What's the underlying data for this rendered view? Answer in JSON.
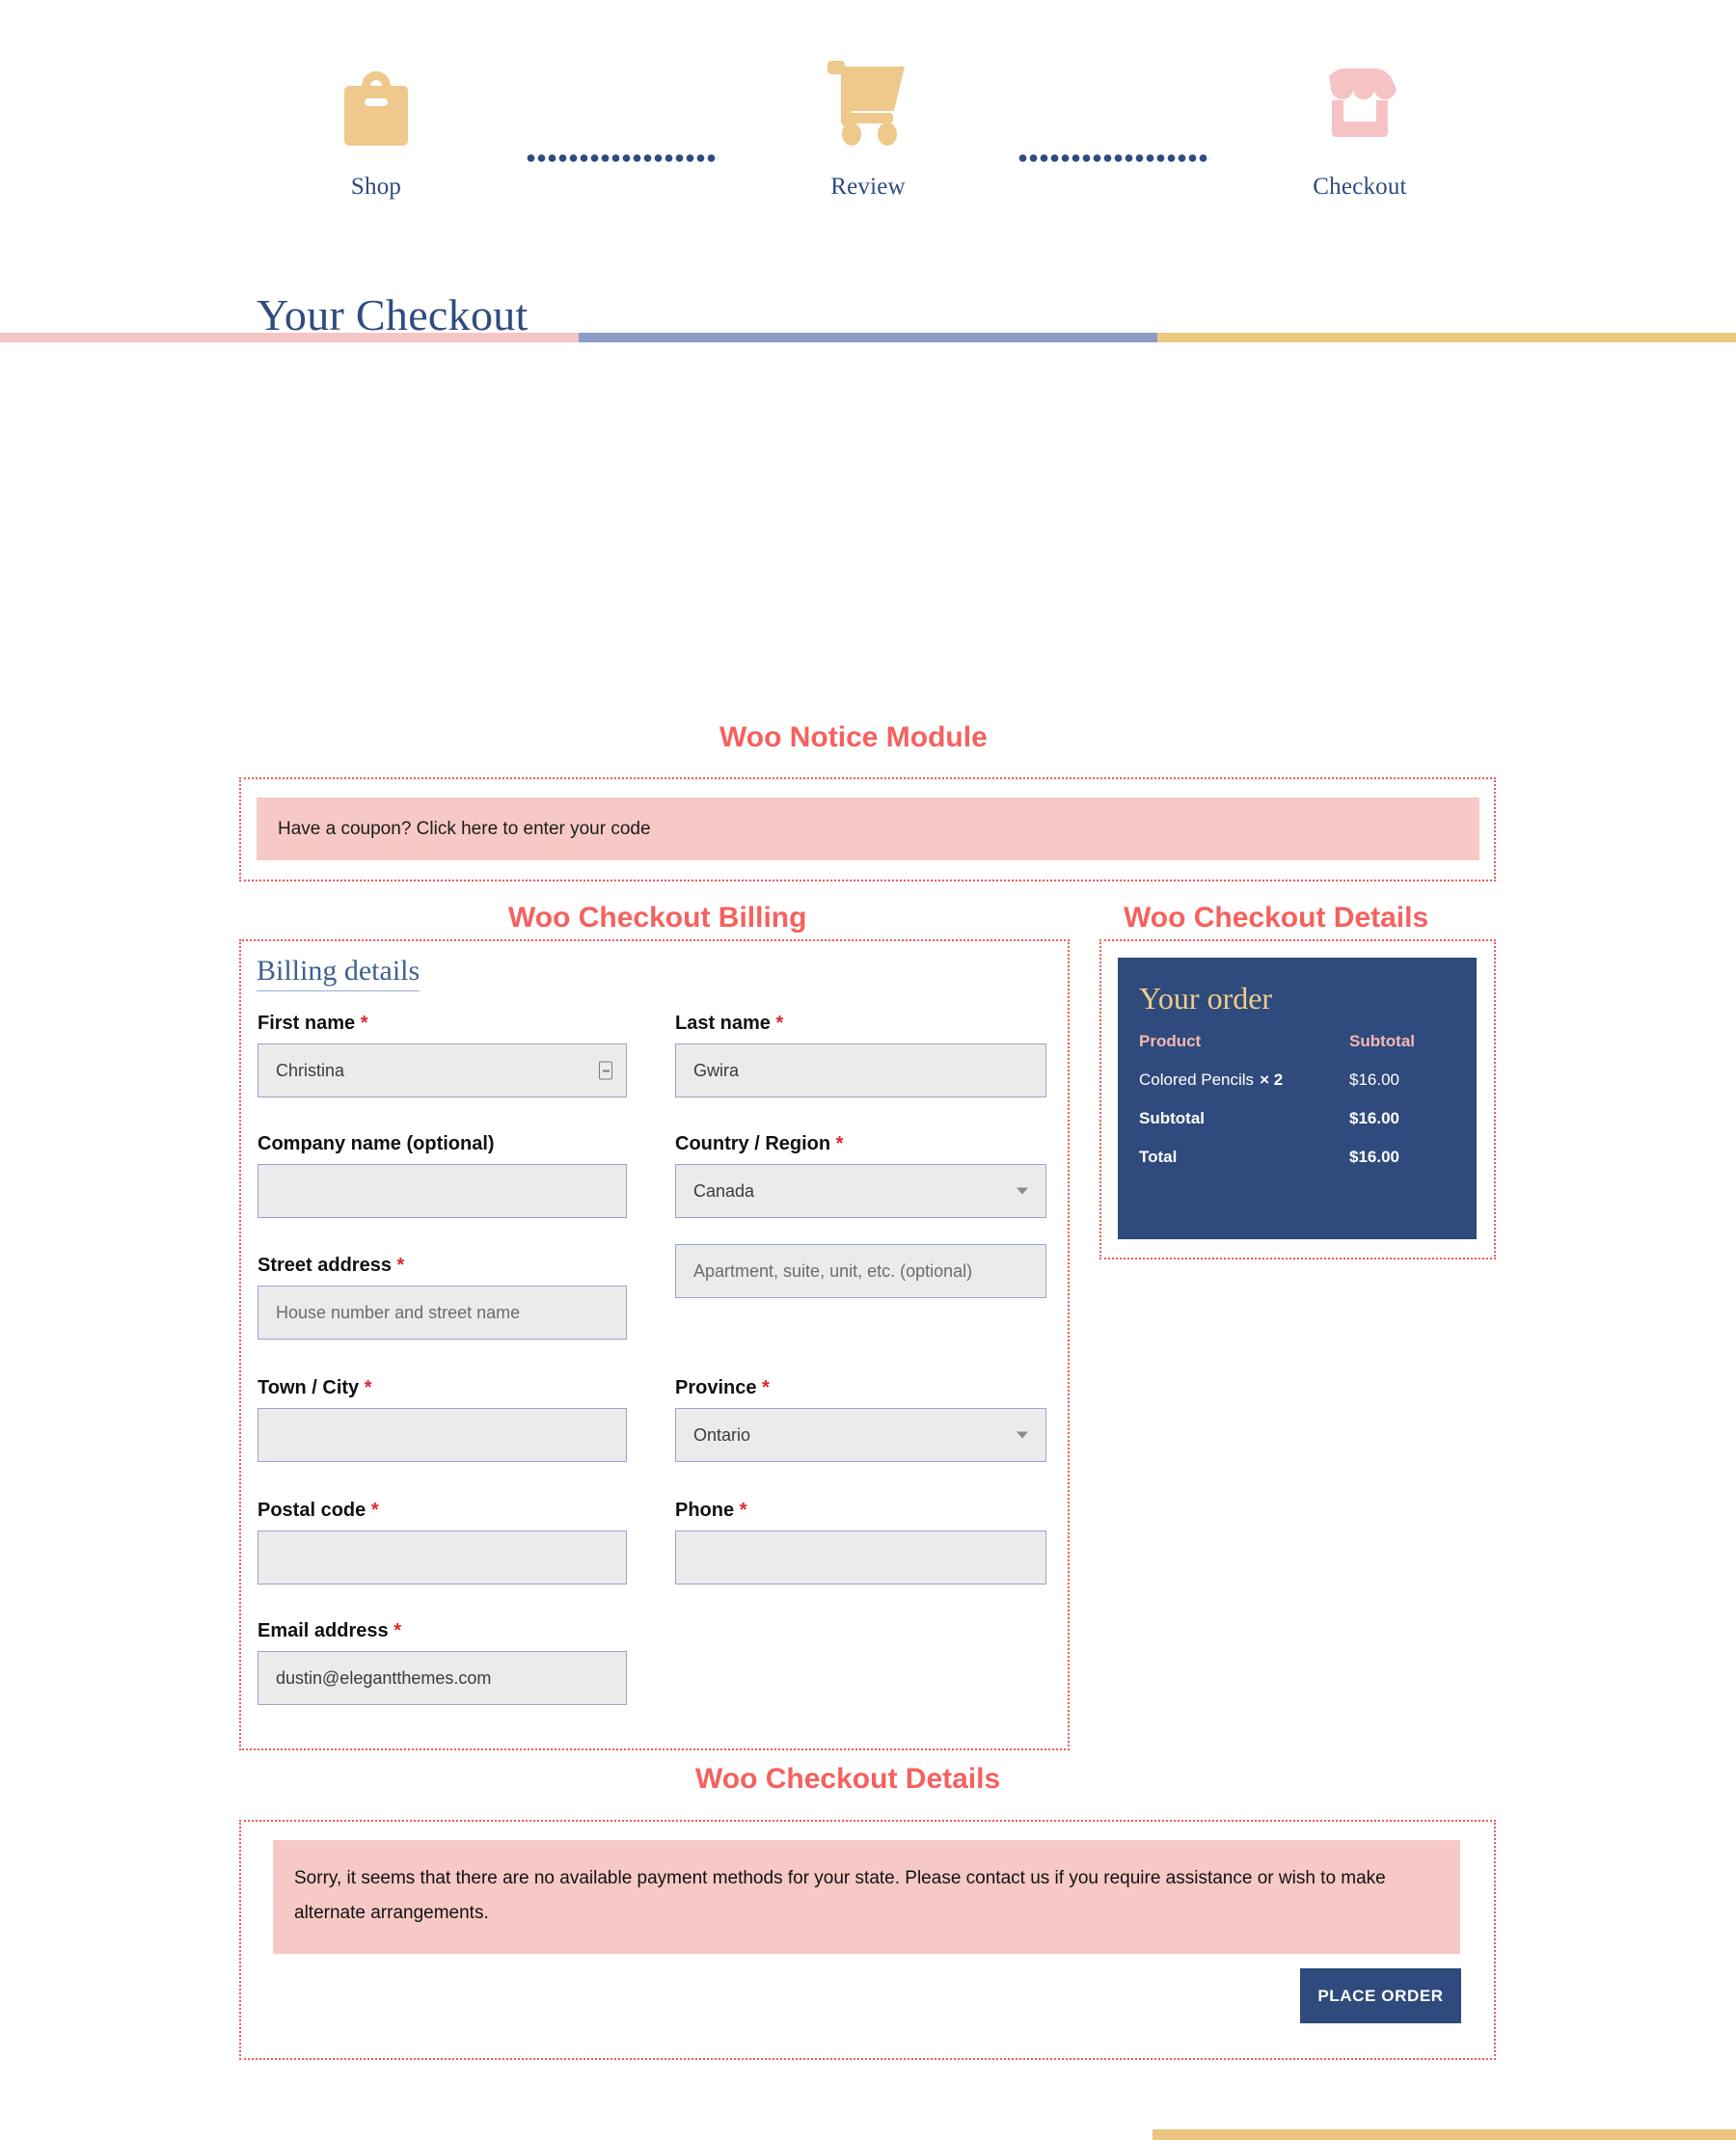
{
  "steps": {
    "items": [
      {
        "label": "Shop",
        "icon": "shopping-bag-icon",
        "color": "#eec98b",
        "state": "done"
      },
      {
        "label": "Review",
        "icon": "shopping-cart-icon",
        "color": "#eec98b",
        "state": "done"
      },
      {
        "label": "Checkout",
        "icon": "storefront-icon",
        "color": "#f6c3c4",
        "state": "current"
      }
    ],
    "connector_icon": "dotted-line-icon"
  },
  "progress": {
    "segments": [
      {
        "name": "shop-segment",
        "color": "#f6c6c7"
      },
      {
        "name": "review-segment",
        "color": "#8f9cc8"
      },
      {
        "name": "checkout-segment",
        "color": "#eec980"
      }
    ]
  },
  "page": {
    "title": "Your Checkout"
  },
  "captions": {
    "notice": "Woo Notice Module",
    "billing": "Woo Checkout Billing",
    "details": "Woo Checkout Details",
    "payment": "Woo Checkout Details"
  },
  "coupon": {
    "text": "Have a coupon? Click here to enter your code"
  },
  "billing": {
    "heading": "Billing details",
    "required_marker": "*",
    "fields": {
      "first_name": {
        "label": "First name",
        "value": "Christina",
        "placeholder": "",
        "icon": "autofill-icon"
      },
      "last_name": {
        "label": "Last name",
        "value": "Gwira",
        "placeholder": ""
      },
      "company": {
        "label": "Company name (optional)",
        "value": "",
        "placeholder": ""
      },
      "country": {
        "label": "Country / Region",
        "value": "Canada",
        "placeholder": "",
        "icon": "chevron-down-icon"
      },
      "street": {
        "label": "Street address",
        "value": "",
        "placeholder": "House number and street name"
      },
      "address2": {
        "label": "",
        "value": "",
        "placeholder": "Apartment, suite, unit, etc. (optional)"
      },
      "city": {
        "label": "Town / City",
        "value": "",
        "placeholder": ""
      },
      "province": {
        "label": "Province",
        "value": "Ontario",
        "placeholder": "",
        "icon": "chevron-down-icon"
      },
      "postal": {
        "label": "Postal code",
        "value": "",
        "placeholder": ""
      },
      "phone": {
        "label": "Phone",
        "value": "",
        "placeholder": ""
      },
      "email": {
        "label": "Email address",
        "value": "dustin@elegantthemes.com",
        "placeholder": ""
      }
    }
  },
  "order": {
    "title": "Your order",
    "col_product": "Product",
    "col_subtotal": "Subtotal",
    "item_name": "Colored Pencils",
    "item_qty": "× 2",
    "item_subtotal": "$16.00",
    "subtotal_label": "Subtotal",
    "subtotal_value": "$16.00",
    "total_label": "Total",
    "total_value": "$16.00"
  },
  "payment": {
    "notice": "Sorry, it seems that there are no available payment methods for your state. Please contact us if you require assistance or wish to make alternate arrangements.",
    "place_order_label": "PLACE ORDER"
  },
  "colors": {
    "navy": "#2f4a7c",
    "coral": "#f4615e",
    "pink": "#f7c9c6",
    "gold": "#eec98b",
    "field_bg": "#ebebeb",
    "field_border": "#9aa4cc"
  }
}
